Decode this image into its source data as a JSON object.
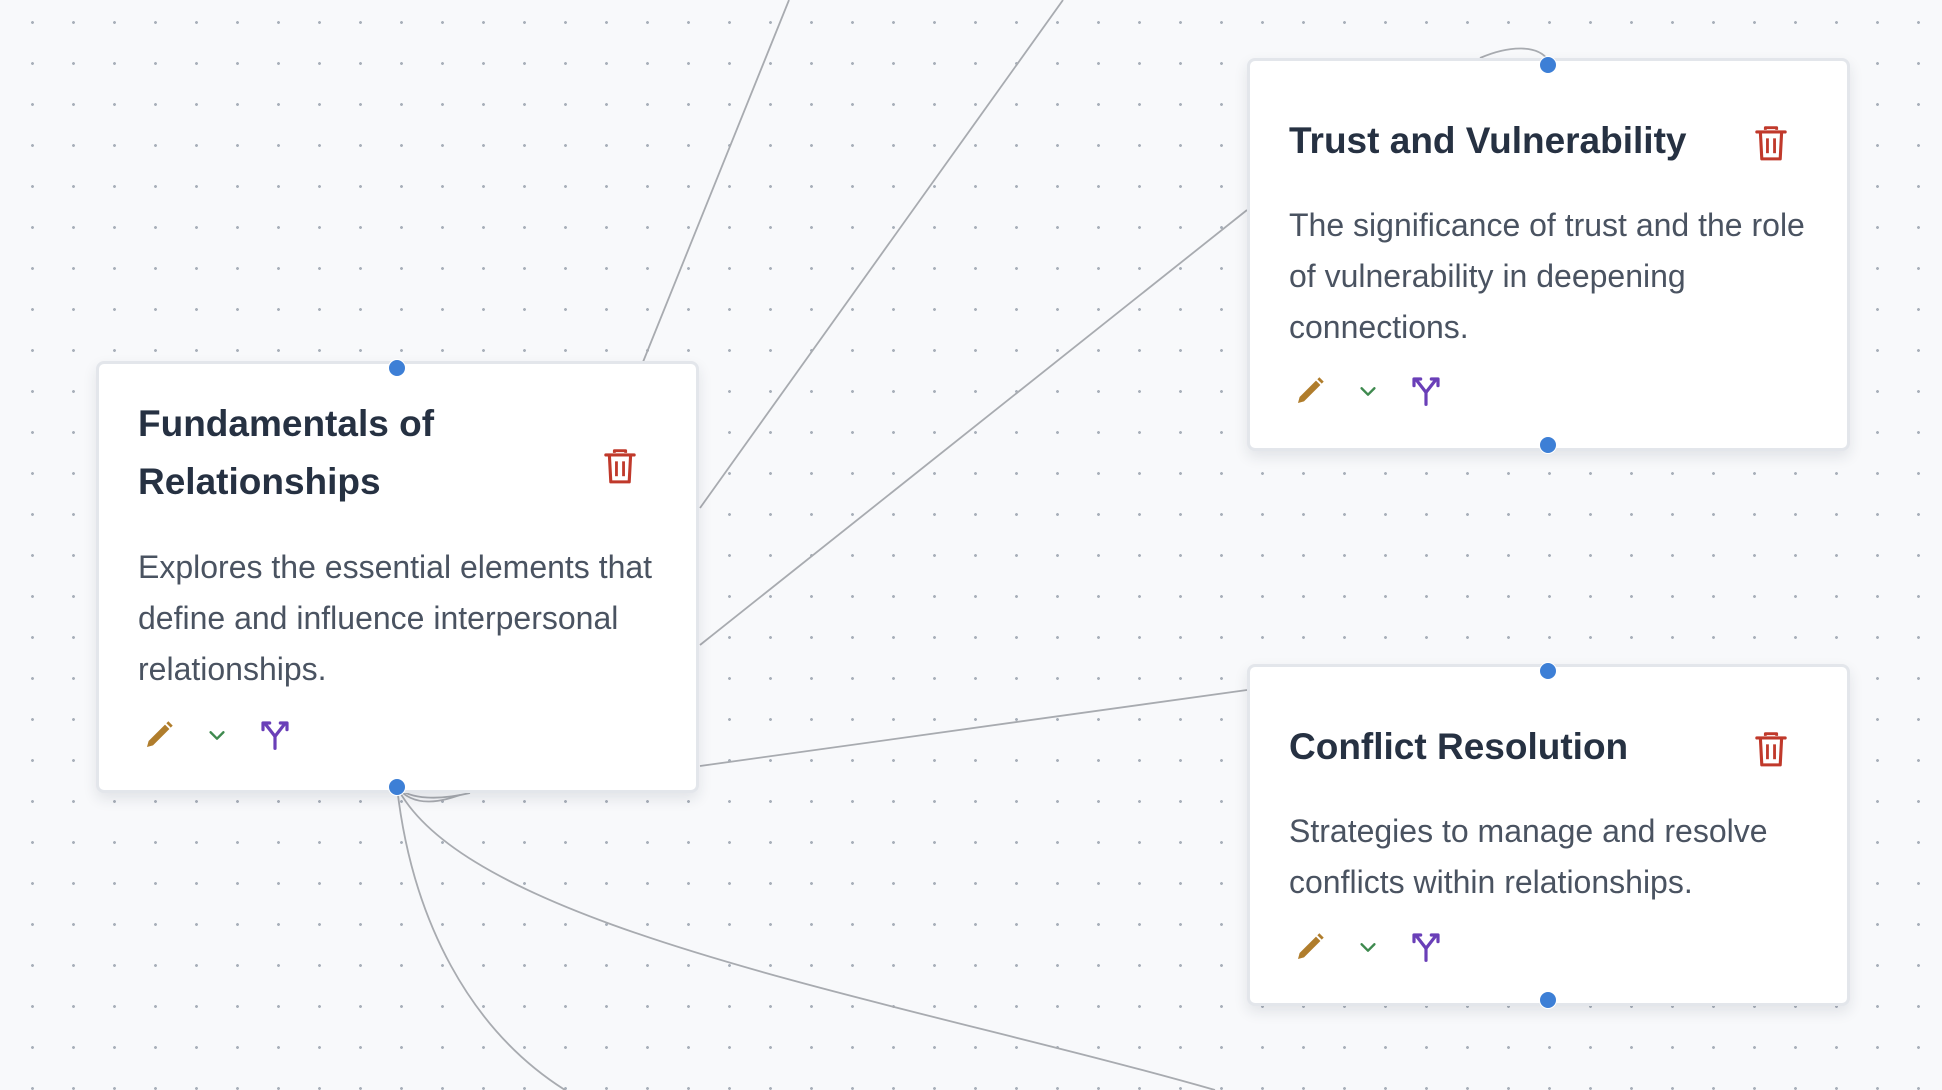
{
  "canvas": {
    "background": "#f8f9fb",
    "dot_color": "#a9b0ba",
    "edge_color": "#a8abb0",
    "handle_color": "#3d7fd6"
  },
  "nodes": [
    {
      "title": "Fundamentals of Relationships",
      "description": "Explores the essential elements that define and influence interpersonal relationships.",
      "icons": [
        "trash-icon",
        "pencil-icon",
        "chevron-down-icon",
        "branch-icon"
      ]
    },
    {
      "title": "Trust and Vulnerability",
      "description": "The significance of trust and the role of vulnerability in deepening connections.",
      "icons": [
        "trash-icon",
        "pencil-icon",
        "chevron-down-icon",
        "branch-icon"
      ]
    },
    {
      "title": "Conflict Resolution",
      "description": "Strategies to manage and resolve conflicts within relationships.",
      "icons": [
        "trash-icon",
        "pencil-icon",
        "chevron-down-icon",
        "branch-icon"
      ]
    }
  ],
  "colors": {
    "delete": "#c0392b",
    "edit": "#b07d2c",
    "expand": "#3f8a4f",
    "branch": "#6a3fb8"
  }
}
